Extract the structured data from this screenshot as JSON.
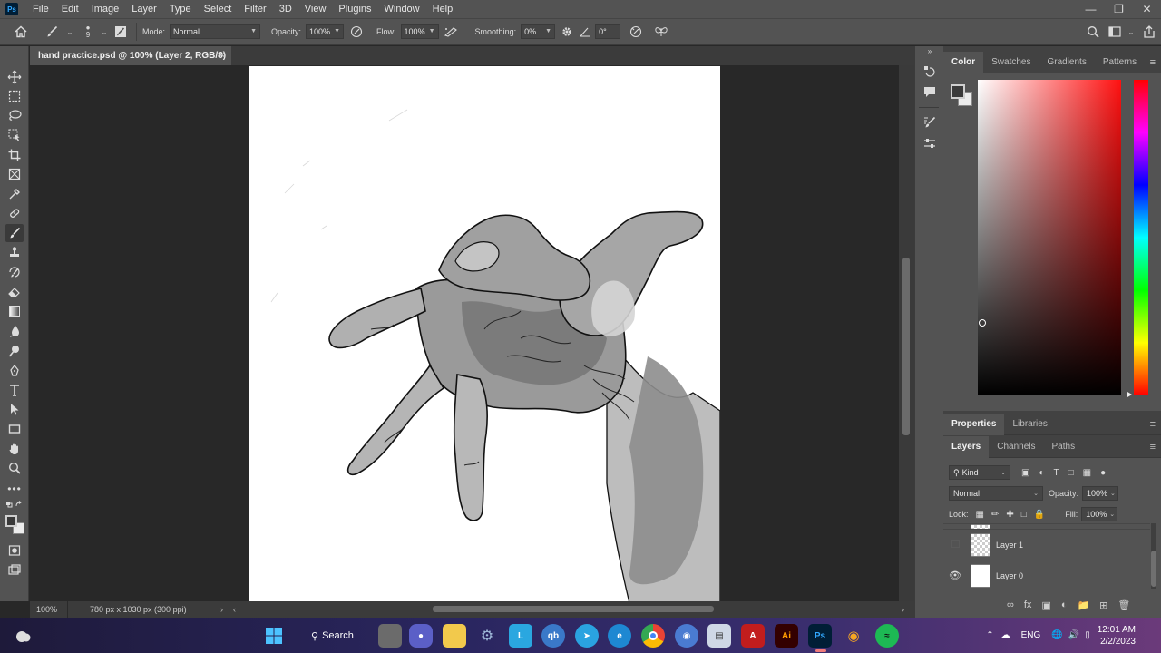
{
  "app": {
    "logo_text": "Ps"
  },
  "menu": [
    "File",
    "Edit",
    "Image",
    "Layer",
    "Type",
    "Select",
    "Filter",
    "3D",
    "View",
    "Plugins",
    "Window",
    "Help"
  ],
  "options_bar": {
    "brush_size": "9",
    "mode_label": "Mode:",
    "mode_value": "Normal",
    "opacity_label": "Opacity:",
    "opacity_value": "100%",
    "flow_label": "Flow:",
    "flow_value": "100%",
    "smoothing_label": "Smoothing:",
    "smoothing_value": "0%",
    "angle_value": "0°"
  },
  "document": {
    "tab_title": "hand practice.psd @ 100% (Layer 2, RGB/8) *"
  },
  "status_bar": {
    "zoom": "100%",
    "doc_info": "780 px x 1030 px (300 ppi)"
  },
  "color_panel": {
    "tabs": [
      "Color",
      "Swatches",
      "Gradients",
      "Patterns"
    ]
  },
  "properties_panel": {
    "tabs": [
      "Properties",
      "Libraries"
    ]
  },
  "layers_panel": {
    "tabs": [
      "Layers",
      "Channels",
      "Paths"
    ],
    "filter_value": "Kind",
    "blend_mode": "Normal",
    "opacity_label": "Opacity:",
    "opacity_value": "100%",
    "lock_label": "Lock:",
    "fill_label": "Fill:",
    "fill_value": "100%",
    "layers": [
      {
        "name": "Layer 1",
        "visible": false
      },
      {
        "name": "Layer 0",
        "visible": true
      }
    ]
  },
  "taskbar": {
    "search_label": "Search",
    "language": "ENG",
    "time": "12:01 AM",
    "date": "2/2/2023"
  }
}
